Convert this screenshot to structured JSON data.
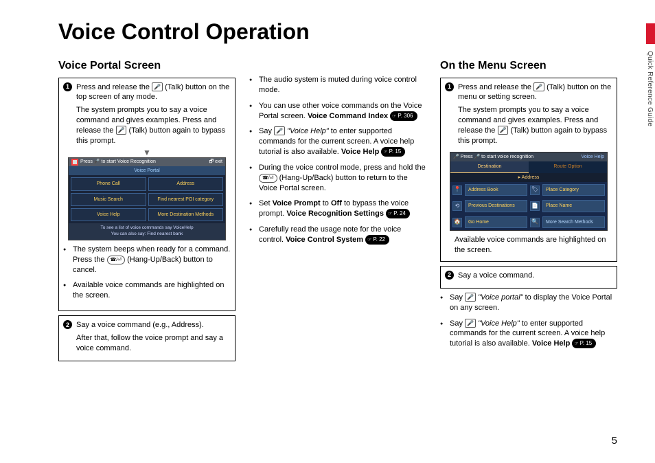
{
  "page_number": "5",
  "side_label": "Quick Reference Guide",
  "title": "Voice Control Operation",
  "left": {
    "heading": "Voice Portal Screen",
    "step1_a": "Press and release the",
    "step1_b": "(Talk) button on the top screen of any mode.",
    "step1_c": "The system prompts you to say a voice command and gives examples. Press and release the",
    "step1_d": "(Talk) button again to bypass this prompt.",
    "screen": {
      "topbar_text": "Press 🎤 to start Voice Recognition",
      "exit_label": "exit",
      "portal_title": "Voice Portal",
      "btns": [
        "Phone Call",
        "Address",
        "Music Search",
        "Find nearest POI category",
        "Voice Help",
        "More Destination Methods"
      ],
      "tip1": "To see a list of voice commands say VoiceHelp",
      "tip2": "You can also say: Find nearest bank"
    },
    "bullet1_a": "The system beeps when ready for a command. Press the",
    "bullet1_b": "(Hang-Up/Back) button to cancel.",
    "bullet2": "Available voice commands are highlighted on the screen.",
    "step2_a": "Say a voice command (e.g., Address).",
    "step2_b": "After that, follow the voice prompt and say a voice command."
  },
  "mid": {
    "b1": "The audio system is muted during voice control mode.",
    "b2_a": "You can use other voice commands on the Voice Portal screen.",
    "b2_bold": "Voice Command Index",
    "b2_page": "P. 306",
    "b3_a": "Say",
    "b3_quote": "\"Voice Help\"",
    "b3_b": "to enter supported commands for the current screen. A voice help tutorial is also available.",
    "b3_bold": "Voice Help",
    "b3_page": "P. 15",
    "b4_a": "During the voice control mode, press and hold the",
    "b4_b": "(Hang-Up/Back) button to return to the Voice Portal screen.",
    "b5_a": "Set",
    "b5_bold1": "Voice Prompt",
    "b5_b": "to",
    "b5_bold2": "Off",
    "b5_c": "to bypass the voice prompt.",
    "b5_bold3": "Voice Recognition Settings",
    "b5_page": "P. 24",
    "b6_a": "Carefully read the usage note for the voice control.",
    "b6_bold": "Voice Control System",
    "b6_page": "P. 22"
  },
  "right": {
    "heading": "On the Menu Screen",
    "step1_a": "Press and release the",
    "step1_b": "(Talk) button on the menu or setting screen.",
    "step1_c": "The system prompts you to say a voice command and gives examples. Press and release the",
    "step1_d": "(Talk) button again to bypass this prompt.",
    "screen": {
      "top_text": "Press 🎤 to start voice recognition",
      "voice_help": "Voice Help",
      "tabs": [
        "Destination",
        "Route Option"
      ],
      "rows": [
        {
          "icon": "📍",
          "l": "Address Book",
          "r": "Place Category"
        },
        {
          "icon": "⟲",
          "l": "Previous Destinations",
          "r": "Place Name"
        },
        {
          "icon": "🏠",
          "l": "Go Home",
          "r": "More Search Methods"
        }
      ],
      "arrow_label": "▸ Address"
    },
    "caption": "Available voice commands are highlighted on the screen.",
    "step2": "Say a voice command.",
    "b1_a": "Say",
    "b1_quote": "\"Voice portal\"",
    "b1_b": "to display the Voice Portal on any screen.",
    "b2_a": "Say",
    "b2_quote": "\"Voice Help\"",
    "b2_b": "to enter supported commands for the current screen. A voice help tutorial is also available.",
    "b2_bold": "Voice Help",
    "b2_page": "P. 15"
  }
}
